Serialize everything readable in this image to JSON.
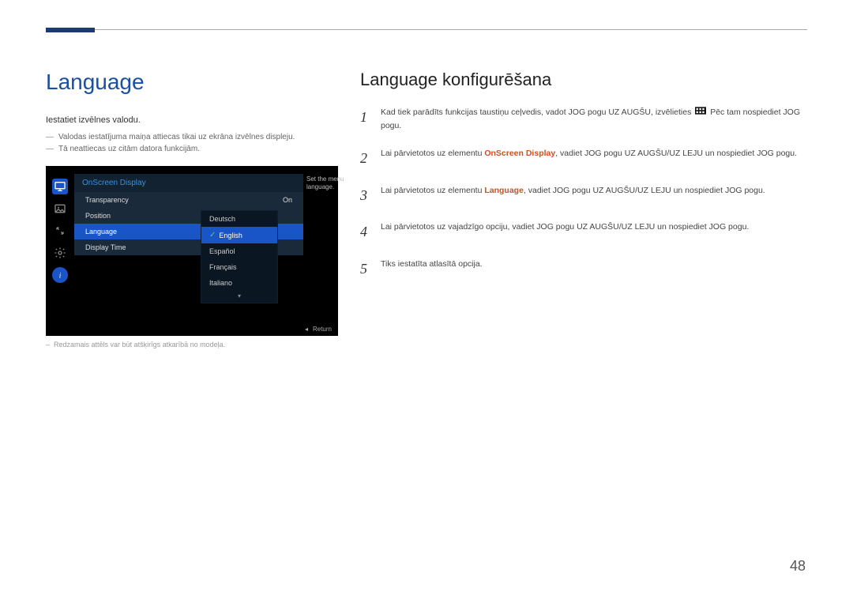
{
  "page": {
    "number": "48"
  },
  "left": {
    "heading": "Language",
    "intro": "Iestatiet izvēlnes valodu.",
    "bullets": [
      "Valodas iestatījuma maiņa attiecas tikai uz ekrāna izvēlnes displeju.",
      "Tā neattiecas uz citām datora funkcijām."
    ],
    "footnote": "Redzamais attēls var būt atšķirīgs atkarībā no modeļa."
  },
  "osd": {
    "title": "OnScreen Display",
    "help": "Set the menu language.",
    "items": [
      {
        "label": "Transparency",
        "value": "On",
        "selected": false
      },
      {
        "label": "Position",
        "value": "",
        "selected": false
      },
      {
        "label": "Language",
        "value": "",
        "selected": true
      },
      {
        "label": "Display Time",
        "value": "",
        "selected": false
      }
    ],
    "submenu": [
      {
        "label": "Deutsch",
        "selected": false
      },
      {
        "label": "English",
        "selected": true
      },
      {
        "label": "Español",
        "selected": false
      },
      {
        "label": "Français",
        "selected": false
      },
      {
        "label": "Italiano",
        "selected": false
      }
    ],
    "return_label": "Return",
    "sidebar_icons": [
      "monitor-icon",
      "picture-icon",
      "resize-icon",
      "gear-icon",
      "info-icon"
    ]
  },
  "right": {
    "heading": "Language konfigurēšana",
    "steps": [
      {
        "num": "1",
        "pre": "Kad tiek parādīts funkcijas taustiņu ceļvedis, vadot JOG pogu UZ AUGŠU, izvēlieties ",
        "post": " Pēc tam nospiediet JOG pogu."
      },
      {
        "num": "2",
        "pre": "Lai pārvietotos uz elementu ",
        "kw": "OnScreen Display",
        "post": ", vadiet JOG pogu UZ AUGŠU/UZ LEJU un nospiediet JOG pogu."
      },
      {
        "num": "3",
        "pre": "Lai pārvietotos uz elementu ",
        "kw": "Language",
        "post": ", vadiet JOG pogu UZ AUGŠU/UZ LEJU un nospiediet JOG pogu."
      },
      {
        "num": "4",
        "text": "Lai pārvietotos uz vajadzīgo opciju, vadiet JOG pogu UZ AUGŠU/UZ LEJU un nospiediet JOG pogu."
      },
      {
        "num": "5",
        "text": "Tiks iestatīta atlasītā opcija."
      }
    ]
  }
}
